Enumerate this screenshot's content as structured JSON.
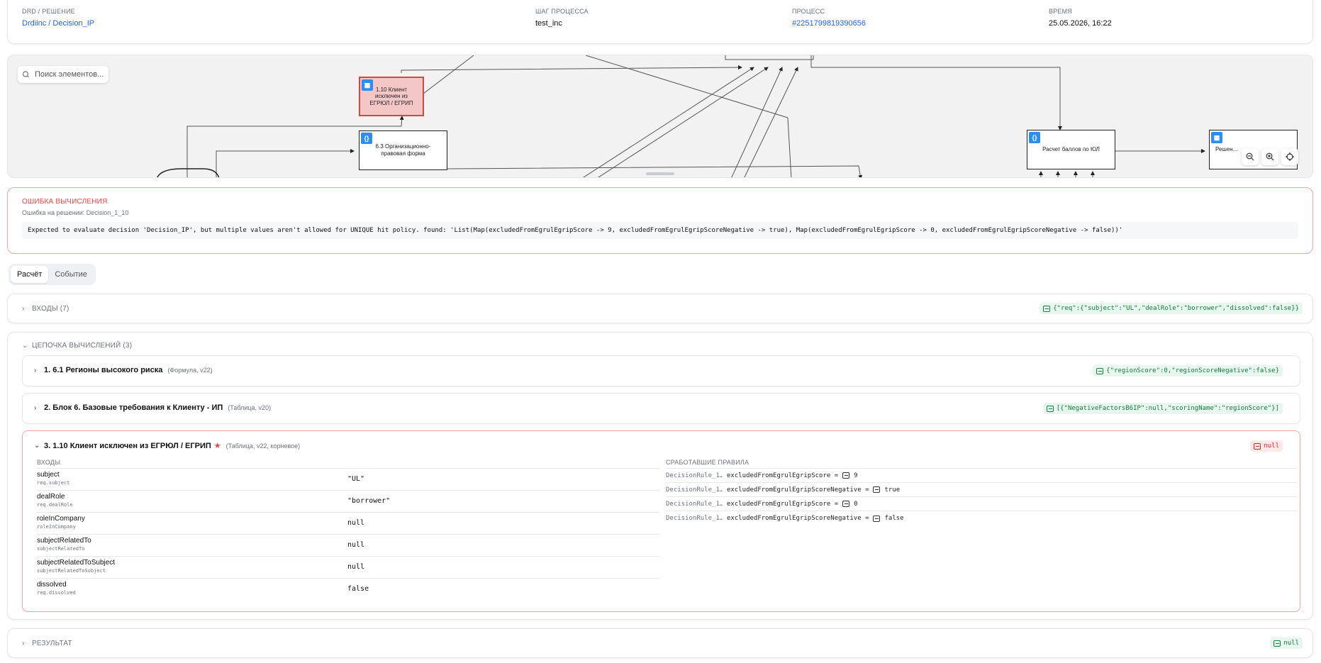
{
  "header": {
    "drd_label": "DRD / РЕШЕНИЕ",
    "drd_value": "Drdiinc / Decision_IP",
    "step_label": "ШАГ ПРОЦЕССА",
    "step_value": "test_inc",
    "process_label": "ПРОЦЕСС",
    "process_value": "#2251799819390656",
    "time_label": "ВРЕМЯ",
    "time_value": "25.05.2026, 16:22"
  },
  "canvas": {
    "search_placeholder": "Поиск элементов...",
    "nodes": {
      "excluded": "1.10 Клиент исключен из ЕГРЮЛ / ЕГРИП",
      "legal_form": "6.3 Организационно-правовая форма",
      "score": "Расчет баллов по ЮЛ",
      "decision": "Решен..."
    }
  },
  "error": {
    "title": "ОШИБКА ВЫЧИСЛЕНИЯ",
    "subtitle": "Ошибка на решении: Decision_1_10",
    "message": "Expected to evaluate decision 'Decision_IP', but multiple values aren't allowed for UNIQUE hit policy. found: 'List(Map(excludedFromEgrulEgripScore -> 9, excludedFromEgrulEgripScoreNegative -> true), Map(excludedFromEgrulEgripScore -> 0, excludedFromEgrulEgripScoreNegative -> false))'"
  },
  "tabs": [
    "Расчёт",
    "Событие"
  ],
  "inputs_section": {
    "label": "ВХОДЫ (7)",
    "badge": "{\"req\":{\"subject\":\"UL\",\"dealRole\":\"borrower\",\"dissolved\":false}}"
  },
  "chain": {
    "label": "ЦЕПОЧКА ВЫЧИСЛЕНИЙ (3)",
    "items": [
      {
        "title": "1. 6.1 Регионы высокого риска",
        "meta": "(Формула, v22)",
        "badge": "{\"regionScore\":0,\"regionScoreNegative\":false}"
      },
      {
        "title": "2. Блок 6. Базовые требования к Клиенту - ИП",
        "meta": "(Таблица, v20)",
        "badge": "[{\"NegativeFactorsB6IP\":null,\"scoringName\":\"regionScore\"}]"
      },
      {
        "title": "3. 1.10 Клиент исключен из ЕГРЮЛ / ЕГРИП",
        "star": "★",
        "meta": "(Таблица, v22, корневое)",
        "badge": "null"
      }
    ],
    "inputs_head": "ВХОДЫ",
    "rules_head": "СРАБОТАВШИЕ ПРАВИЛА",
    "inputs": [
      {
        "name": "subject",
        "path": "req.subject",
        "value": "\"UL\""
      },
      {
        "name": "dealRole",
        "path": "req.dealRole",
        "value": "\"borrower\""
      },
      {
        "name": "roleInCompany",
        "path": "roleInCompany",
        "value": "null"
      },
      {
        "name": "subjectRelatedTo",
        "path": "subjectRelatedTo",
        "value": "null"
      },
      {
        "name": "subjectRelatedToSubject",
        "path": "subjectRelatedToSubject",
        "value": "null"
      },
      {
        "name": "dissolved",
        "path": "req.dissolved",
        "value": "false"
      }
    ],
    "rules": [
      {
        "id": "DecisionRule_1…",
        "key": "excludedFromEgrulEgripScore =",
        "value": "9"
      },
      {
        "id": "DecisionRule_1…",
        "key": "excludedFromEgrulEgripScoreNegative =",
        "value": "true"
      },
      {
        "id": "DecisionRule_1…",
        "key": "excludedFromEgrulEgripScore =",
        "value": "0"
      },
      {
        "id": "DecisionRule_1…",
        "key": "excludedFromEgrulEgripScoreNegative =",
        "value": "false"
      }
    ]
  },
  "result_section": {
    "label": "РЕЗУЛЬТАТ",
    "badge": "null"
  },
  "colors": {
    "accent": "#2563eb",
    "error": "#ef4444",
    "success": "#15803d",
    "node_icon": "#2b8ef0"
  }
}
